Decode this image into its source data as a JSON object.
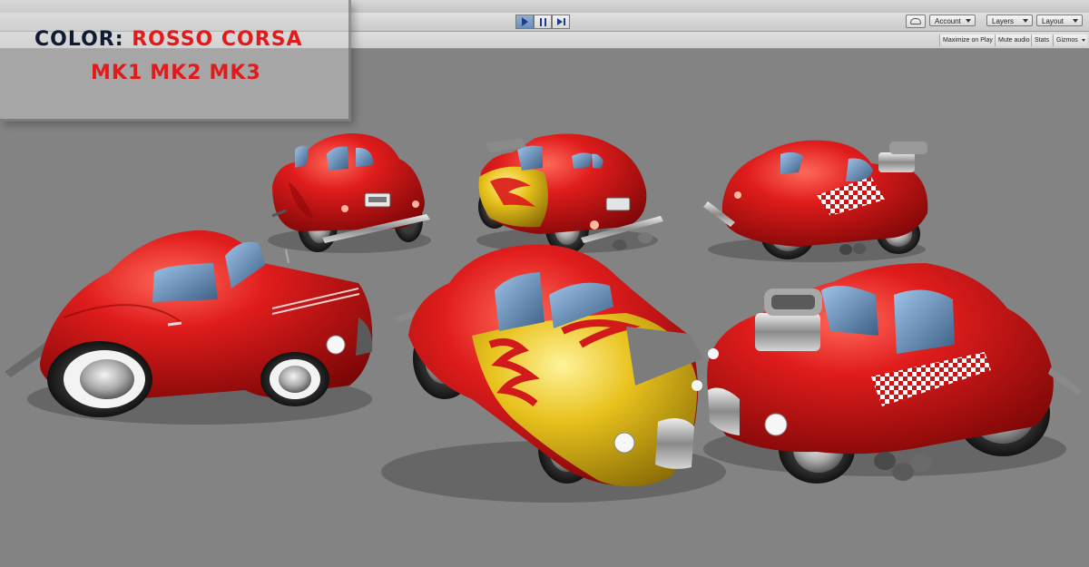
{
  "toolbar": {
    "account_label": "Account",
    "layers_label": "Layers",
    "layout_label": "Layout"
  },
  "game_view": {
    "maximize_label": "Maximize on Play",
    "mute_label": "Mute audio",
    "stats_label": "Stats",
    "gizmos_label": "Gizmos"
  },
  "overlay": {
    "color_key": "COLOR:",
    "color_value": "ROSSO CORSA",
    "variants": [
      "MK1",
      "MK2",
      "MK3"
    ]
  },
  "colors": {
    "car_body": "#d41414",
    "flame": "#e6c01a",
    "checker": "#ffffff",
    "background": "#838383"
  }
}
